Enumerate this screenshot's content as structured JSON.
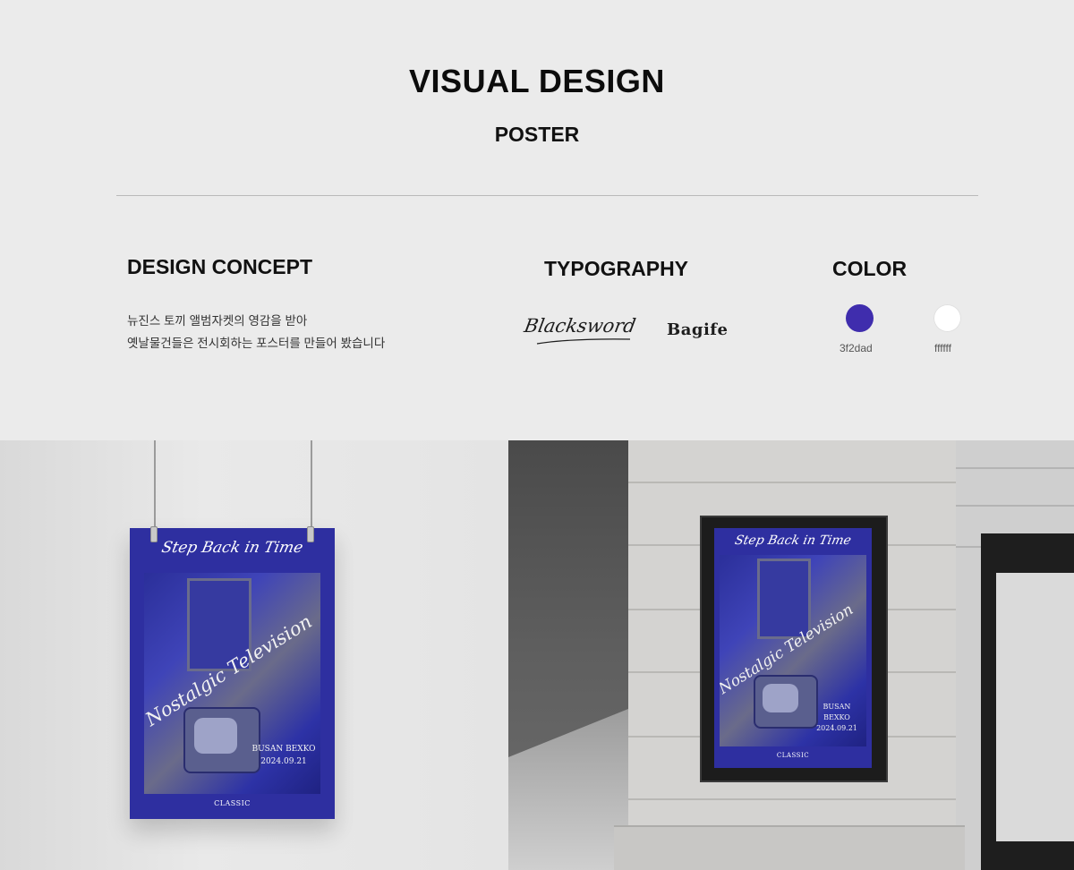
{
  "header": {
    "title": "VISUAL DESIGN",
    "subtitle": "POSTER"
  },
  "concept": {
    "title": "DESIGN CONCEPT",
    "lines": [
      "뉴진스 토끼 앨범자켓의 영감을 받아",
      "옛날물건들은 전시회하는 포스터를 만들어 봤습니다"
    ]
  },
  "typography": {
    "title": "TYPOGRAPHY",
    "fonts": [
      "Blacksword",
      "Bagife"
    ]
  },
  "color": {
    "title": "COLOR",
    "swatches": [
      {
        "hex": "#3f2dad",
        "label": "3f2dad"
      },
      {
        "hex": "#ffffff",
        "label": "ffffff"
      }
    ]
  },
  "poster": {
    "top_text": "Step Back in Time",
    "mid_text": "Nostalgic Television",
    "info_line1": "BUSAN BEXKO",
    "info_line2": "2024.09.21",
    "bottom_text": "CLASSIC",
    "background": "#2e2fa0"
  }
}
